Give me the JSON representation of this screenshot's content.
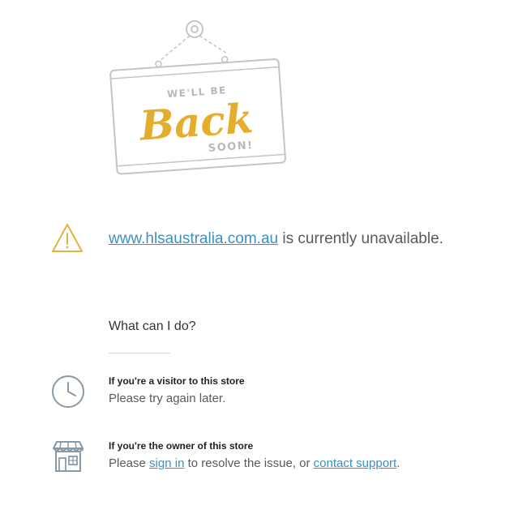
{
  "hero": {
    "top_text": "WE'LL BE",
    "main_text": "Back",
    "bottom_text": "SOON!",
    "accent_color": "#e3ae2c",
    "icon": "hanging-sign-icon"
  },
  "status": {
    "domain_link": "www.hlsaustralia.com.au",
    "message": " is currently unavailable.",
    "icon": "warning-icon",
    "icon_color": "#e3b23c"
  },
  "help": {
    "heading": "What can I do?",
    "visitor": {
      "title": "If you're a visitor to this store",
      "description": "Please try again later.",
      "icon": "clock-icon"
    },
    "owner": {
      "title": "If you're the owner of this store",
      "desc_prefix": "Please ",
      "sign_in_label": "sign in",
      "desc_middle": " to resolve the issue, or ",
      "contact_label": "contact support",
      "desc_suffix": ".",
      "icon": "store-icon"
    }
  },
  "colors": {
    "link": "#3d8fc1",
    "text": "#5a5a5a",
    "icon_gray": "#8a9aa5"
  }
}
